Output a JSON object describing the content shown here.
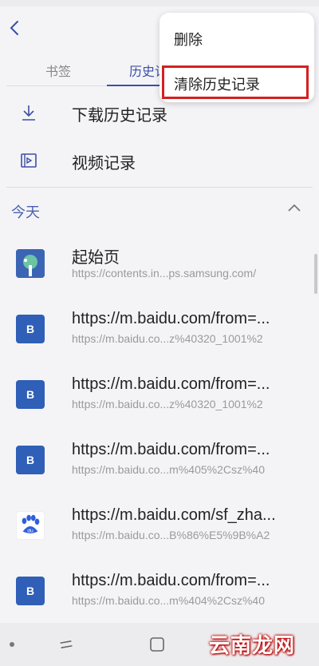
{
  "tabs": {
    "bookmarks": "书签",
    "history": "历史记"
  },
  "actions": [
    {
      "label": "下载历史记录",
      "icon": "download-icon"
    },
    {
      "label": "视频记录",
      "icon": "video-icon"
    }
  ],
  "section": {
    "title": "今天"
  },
  "history_items": [
    {
      "title": "起始页",
      "url": "https://contents.in...ps.samsung.com/",
      "favicon": "samsung-start-icon"
    },
    {
      "title": "https://m.baidu.com/from=...",
      "url": "https://m.baidu.co...z%40320_1001%2",
      "favicon": "B"
    },
    {
      "title": "https://m.baidu.com/from=...",
      "url": "https://m.baidu.co...z%40320_1001%2",
      "favicon": "B"
    },
    {
      "title": "https://m.baidu.com/from=...",
      "url": "https://m.baidu.co...m%405%2Csz%40",
      "favicon": "B"
    },
    {
      "title": "https://m.baidu.com/sf_zha...",
      "url": "https://m.baidu.co...B%86%E5%9B%A2",
      "favicon": "baidu-paw-icon"
    },
    {
      "title": "https://m.baidu.com/from=...",
      "url": "https://m.baidu.co...m%404%2Csz%40",
      "favicon": "B"
    }
  ],
  "menu": {
    "delete": "删除",
    "clear_history": "清除历史记录"
  },
  "watermark": "云南龙网",
  "colors": {
    "accent": "#3b4fa8",
    "highlight_box": "#d42020",
    "favicon_blue": "#2f5fb7"
  }
}
